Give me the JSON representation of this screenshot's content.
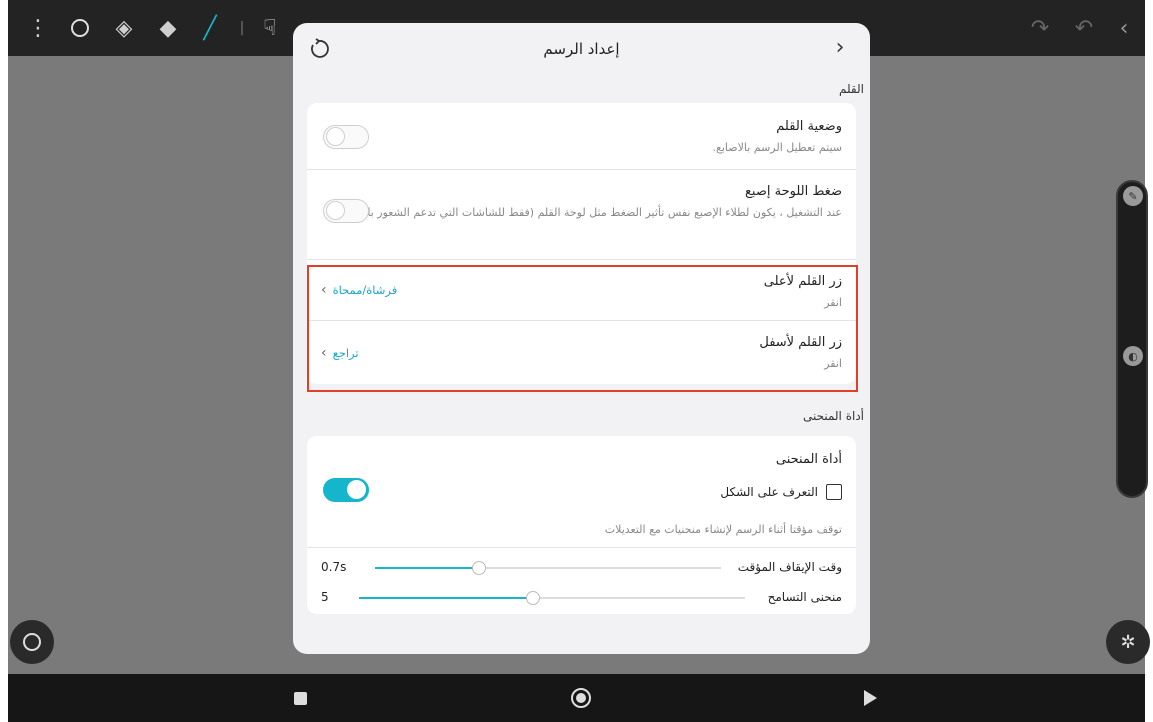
{
  "dialog": {
    "title": "إعداد الرسم",
    "pen_section": "القلم",
    "pen_mode": {
      "title": "وضعية القلم",
      "subtitle": "سيتم تعطيل الرسم بالاصابع.",
      "on": false
    },
    "finger_pressure": {
      "title": "ضغط اللوحة إصبع",
      "subtitle": "عند التشغيل ، يكون لطلاء الإصبع نفس تأثير الضغط مثل لوحة القلم (فقط للشاشات التي تدعم الشعور بالضغط)",
      "on": false
    },
    "pen_upper": {
      "title": "زر القلم لأعلى",
      "subtitle": "انقر",
      "value": "فرشاة/ممحاة"
    },
    "pen_lower": {
      "title": "زر القلم لأسفل",
      "subtitle": "انقر",
      "value": "تراجع"
    },
    "curve_section": "أداة المنحنى",
    "curve_tool": {
      "title": "أداة المنحنى",
      "on": true,
      "shape_recognition": "التعرف على الشكل",
      "hint": "توقف مؤقتا أثناء الرسم لإنشاء منحنيات مع التعديلات"
    },
    "pause_time": {
      "label": "وقت الإيقاف المؤقت",
      "value": "0.7s",
      "fraction": 0.3
    },
    "tolerance": {
      "label": "منحنى التسامح",
      "value": "5",
      "fraction": 0.45
    }
  },
  "colors": {
    "accent": "#15b5cc",
    "highlight": "#e0402a"
  }
}
